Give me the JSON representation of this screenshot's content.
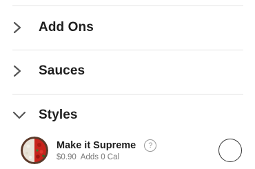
{
  "sections": [
    {
      "label": "Add Ons",
      "state": "collapsed",
      "icon": "chevron-right-icon"
    },
    {
      "label": "Sauces",
      "state": "collapsed",
      "icon": "chevron-right-icon"
    },
    {
      "label": "Styles",
      "state": "expanded",
      "icon": "chevron-down-icon"
    }
  ],
  "styles_option": {
    "name": "Make it Supreme",
    "help_icon": "?",
    "price": "$0.90",
    "calories": "Adds 0 Cal",
    "selected": false
  },
  "colors": {
    "text": "#1e1e1e",
    "muted": "#777777",
    "divider": "#e3e3e3"
  }
}
